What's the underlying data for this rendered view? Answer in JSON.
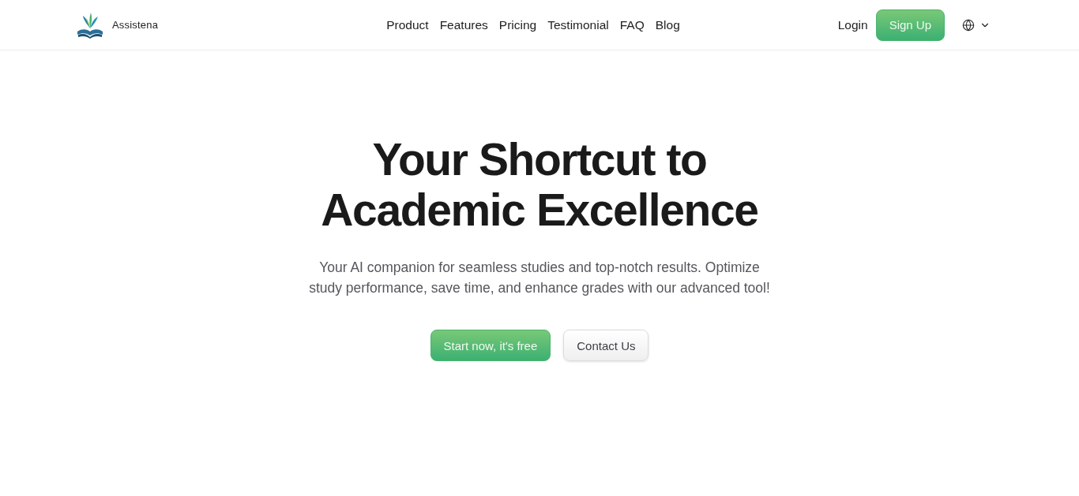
{
  "header": {
    "brand": "Assistena",
    "nav": [
      {
        "label": "Product"
      },
      {
        "label": "Features"
      },
      {
        "label": "Pricing"
      },
      {
        "label": "Testimonial"
      },
      {
        "label": "FAQ"
      },
      {
        "label": "Blog"
      }
    ],
    "login": "Login",
    "signup": "Sign Up"
  },
  "hero": {
    "title": "Your Shortcut to Academic Excellence",
    "subtitle": "Your AI companion for seamless studies and top-notch results. Optimize study performance, save time, and enhance grades with our advanced tool!",
    "buttons": [
      {
        "label": "Start now, it's free",
        "kind": "primary"
      },
      {
        "label": "Contact Us",
        "kind": "secondary"
      }
    ]
  }
}
